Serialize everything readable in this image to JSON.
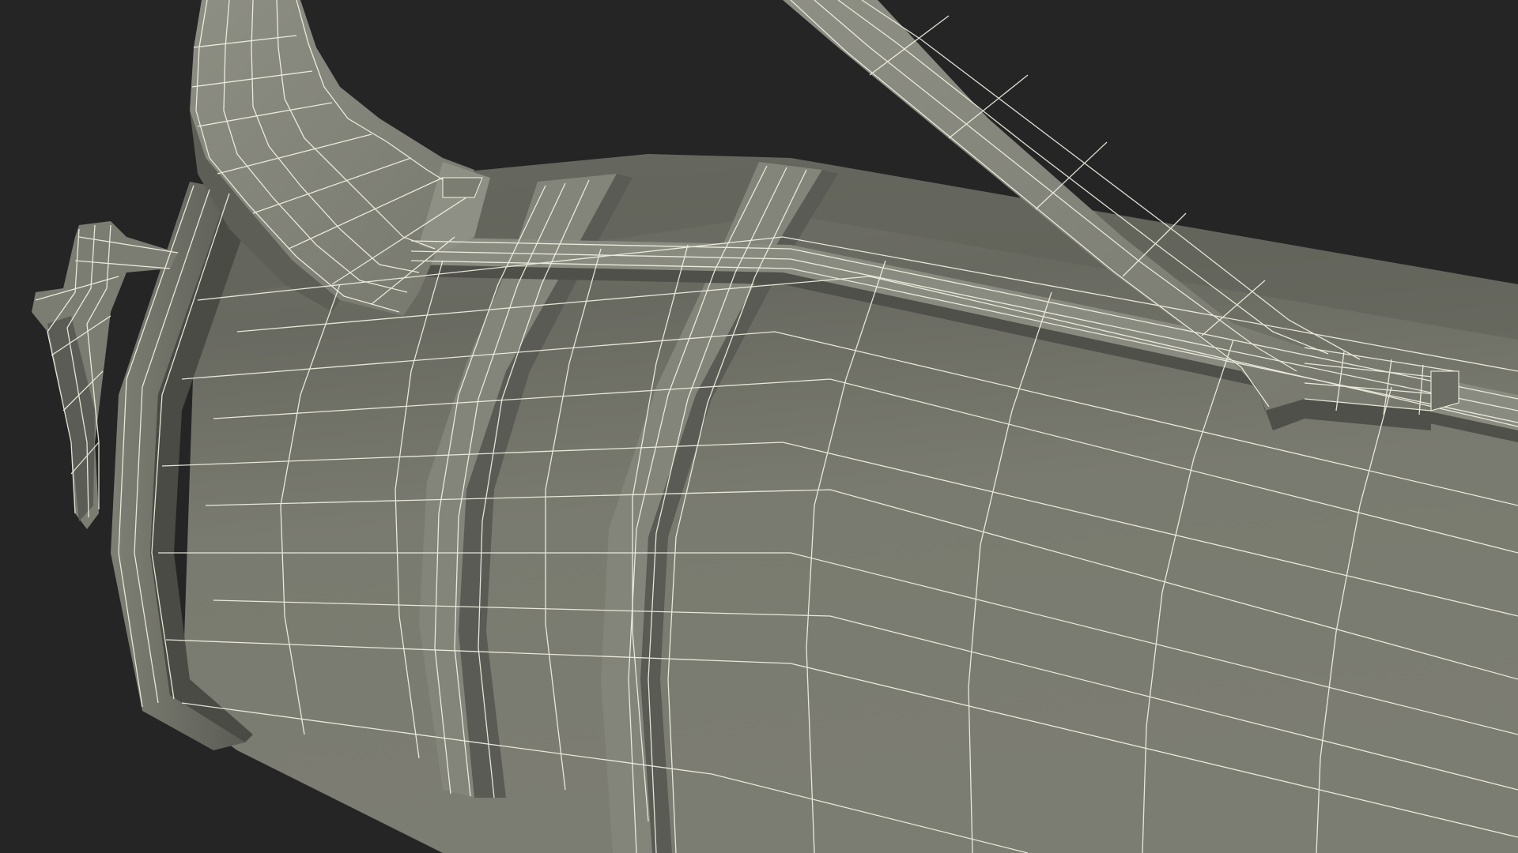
{
  "scene": {
    "subject": "wireframe-tube-with-straps",
    "colors": {
      "background": "#252525",
      "surface_light": "#8b8b80",
      "surface_mid": "#7a7b70",
      "surface_dark": "#5d5e56",
      "surface_shadow": "#3e3f3a",
      "wire": "#f4f4e6"
    }
  }
}
